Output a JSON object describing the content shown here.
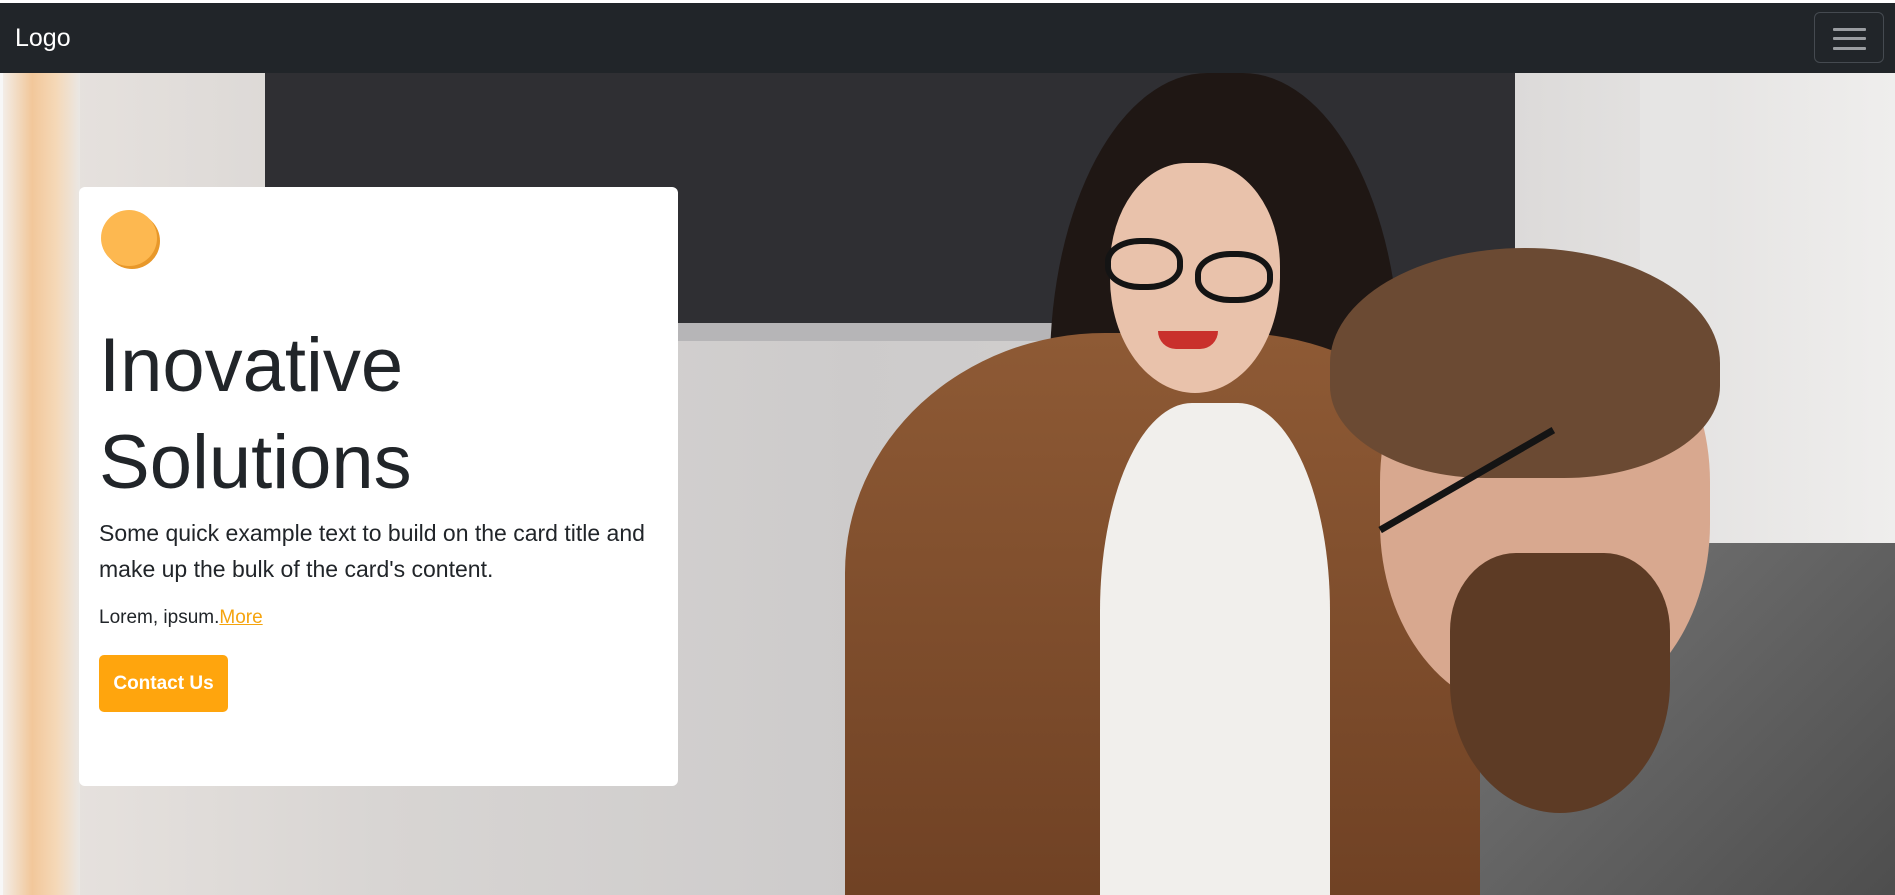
{
  "navbar": {
    "brand": "Logo",
    "toggler_icon": "hamburger-menu-icon",
    "background": "#212529"
  },
  "hero": {
    "card": {
      "decor_icon": "orange-circle",
      "title_line1": "Inovative",
      "title_line2": "Solutions",
      "text": "Some quick example text to build on the card title and make up the bulk of the card's content.",
      "small_text": "Lorem, ipsum.",
      "more_link": "More",
      "button_label": "Contact Us"
    },
    "colors": {
      "accent": "#ffa50d",
      "link": "#f5a40e",
      "dot": "#fdb850"
    }
  }
}
